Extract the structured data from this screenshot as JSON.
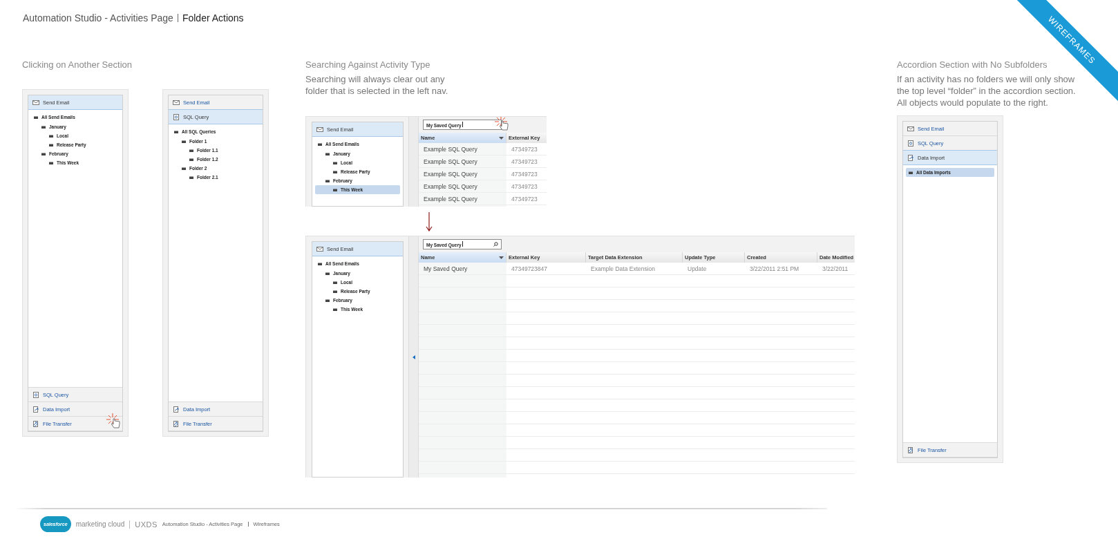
{
  "header": {
    "title": "Automation Studio - Activities Page",
    "subtitle": "Folder Actions"
  },
  "ribbon": "WIREFRAMES",
  "sections": [
    {
      "heading": "Clicking on Another Section",
      "mockups": [
        {
          "kind": "accordion",
          "sections": [
            {
              "kind": "email",
              "label": "Send Email",
              "expanded": true,
              "clicked": false
            },
            {
              "kind": "query",
              "label": "SQL Query",
              "expanded": false,
              "clicked": false
            },
            {
              "kind": "import",
              "label": "Data Import",
              "expanded": false,
              "clicked": false
            },
            {
              "kind": "transfer",
              "label": "File Transfer",
              "expanded": false,
              "clicked": true
            }
          ],
          "tree": [
            {
              "label": "All Send Emails",
              "selected": false,
              "children": [
                {
                  "label": "January",
                  "selected": false,
                  "children": [
                    {
                      "label": "Local",
                      "selected": false
                    },
                    {
                      "label": "Release Party",
                      "selected": false
                    }
                  ]
                },
                {
                  "label": "February",
                  "selected": false,
                  "children": [
                    {
                      "label": "This Week",
                      "selected": false
                    }
                  ]
                }
              ]
            }
          ]
        },
        {
          "kind": "accordion",
          "sections": [
            {
              "kind": "email",
              "label": "Send Email",
              "expanded": false,
              "clicked": false
            },
            {
              "kind": "query",
              "label": "SQL Query",
              "expanded": true,
              "clicked": false
            },
            {
              "kind": "import",
              "label": "Data Import",
              "expanded": false,
              "clicked": false
            },
            {
              "kind": "transfer",
              "label": "File Transfer",
              "expanded": false,
              "clicked": false
            }
          ],
          "tree": [
            {
              "label": "All SQL Queries",
              "selected": false,
              "children": [
                {
                  "label": "Folder 1",
                  "selected": false,
                  "children": [
                    {
                      "label": "Folder 1.1",
                      "selected": false
                    },
                    {
                      "label": "Folder 1.2",
                      "selected": false
                    }
                  ]
                },
                {
                  "label": "Folder 2",
                  "selected": false,
                  "children": [
                    {
                      "label": "Folder 2.1",
                      "selected": false
                    }
                  ]
                }
              ]
            }
          ]
        }
      ]
    },
    {
      "heading": "Searching Against Activity Type",
      "description": "Searching will always clear out any folder that is selected in the left nav.",
      "mockups": [
        {
          "kind": "browser",
          "nav": {
            "sections": [
              {
                "kind": "email",
                "label": "Send Email",
                "expanded": true,
                "clicked": false
              }
            ],
            "tree": [
              {
                "label": "All Send Emails",
                "selected": false,
                "children": [
                  {
                    "label": "January",
                    "selected": false,
                    "children": [
                      {
                        "label": "Local",
                        "selected": false
                      },
                      {
                        "label": "Release Party",
                        "selected": false
                      }
                    ]
                  },
                  {
                    "label": "February",
                    "selected": false,
                    "children": [
                      {
                        "label": "This Week",
                        "selected": true
                      }
                    ]
                  }
                ]
              }
            ]
          },
          "search": {
            "value": "My Saved Query",
            "focused": true,
            "clicked": true
          },
          "collapse_handle": false,
          "columns": [
            {
              "label": "Name",
              "sorted": true
            },
            {
              "label": "External Key",
              "sorted": false
            }
          ],
          "rows": [
            [
              "Example SQL Query",
              "47349723"
            ],
            [
              "Example SQL Query",
              "47349723"
            ],
            [
              "Example SQL Query",
              "47349723"
            ],
            [
              "Example SQL Query",
              "47349723"
            ],
            [
              "Example SQL Query",
              "47349723"
            ]
          ]
        },
        {
          "kind": "browser",
          "nav": {
            "sections": [
              {
                "kind": "email",
                "label": "Send Email",
                "expanded": true,
                "clicked": false
              }
            ],
            "tree": [
              {
                "label": "All Send Emails",
                "selected": false,
                "children": [
                  {
                    "label": "January",
                    "selected": false,
                    "children": [
                      {
                        "label": "Local",
                        "selected": false
                      },
                      {
                        "label": "Release Party",
                        "selected": false
                      }
                    ]
                  },
                  {
                    "label": "February",
                    "selected": false,
                    "children": [
                      {
                        "label": "This Week",
                        "selected": false
                      }
                    ]
                  }
                ]
              }
            ]
          },
          "search": {
            "value": "My Saved Query",
            "focused": true,
            "clicked": false
          },
          "collapse_handle": true,
          "columns": [
            {
              "label": "Name",
              "sorted": true
            },
            {
              "label": "External Key",
              "sorted": false
            },
            {
              "label": "Target Data Extension",
              "sorted": false
            },
            {
              "label": "Update Type",
              "sorted": false
            },
            {
              "label": "Created",
              "sorted": false
            },
            {
              "label": "Date Modified",
              "sorted": false
            }
          ],
          "rows": [
            [
              "My Saved Query",
              "47349723847",
              "Example Data Extension",
              "Update",
              "3/22/2011 2:51 PM",
              "3/22/2011"
            ]
          ]
        }
      ]
    },
    {
      "heading": "Accordion Section with No Subfolders",
      "description": "If an activity has no folders we will only show the top level “folder” in the accordion section. All objects would populate to the right.",
      "mockups": [
        {
          "kind": "accordion",
          "sections": [
            {
              "kind": "email",
              "label": "Send Email",
              "expanded": false,
              "clicked": false
            },
            {
              "kind": "query",
              "label": "SQL Query",
              "expanded": false,
              "clicked": false
            },
            {
              "kind": "import",
              "label": "Data Import",
              "expanded": true,
              "clicked": false
            },
            {
              "kind": "transfer",
              "label": "File Transfer",
              "expanded": false,
              "clicked": false
            }
          ],
          "tree": [
            {
              "label": "All Data Imports",
              "selected": true
            }
          ]
        }
      ]
    }
  ],
  "footer": {
    "brand": "salesforce",
    "product": "marketing cloud",
    "team": "UXDS",
    "document": "Automation Studio - Activities Page",
    "doc_type": "Wireframes"
  }
}
